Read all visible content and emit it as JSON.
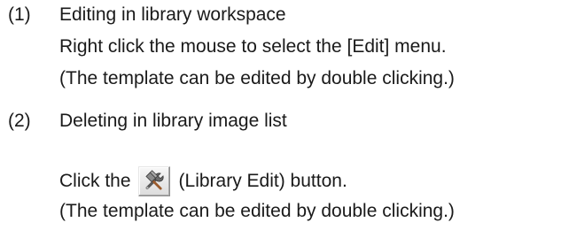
{
  "section1": {
    "number": "(1)",
    "title": "Editing in library workspace",
    "line2": "Right click the mouse to select the [Edit] menu.",
    "line3": "(The template can be edited by double clicking.)"
  },
  "section2": {
    "number": "(2)",
    "title": "Deleting in library image list",
    "click_prefix": "Click the",
    "click_suffix": "(Library Edit) button.",
    "line3": "(The template can be edited by double clicking.)"
  },
  "icons": {
    "library_edit_button": "hammer-and-wrench-icon"
  }
}
